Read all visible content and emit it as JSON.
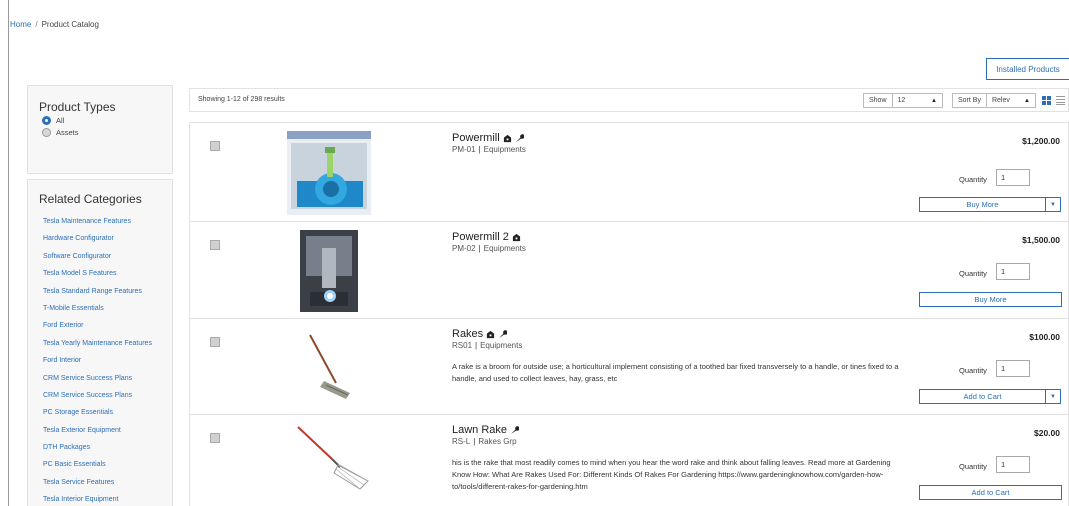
{
  "breadcrumb": {
    "home": "Home",
    "separator": "/",
    "current": "Product Catalog"
  },
  "header": {
    "installed_products": "Installed Products"
  },
  "sidebar": {
    "product_types": {
      "title": "Product Types",
      "options": [
        {
          "label": "All",
          "selected": true
        },
        {
          "label": "Assets",
          "selected": false
        }
      ]
    },
    "related_categories": {
      "title": "Related Categories",
      "items": [
        "Tesla Maintenance Features",
        "Hardware Configurator",
        "Software Configurator",
        "Tesla Model S Features",
        "Tesla Standard Range Features",
        "T-Mobile Essentials",
        "Ford Exterior",
        "Tesla Yearly Maintenance Features",
        "Ford Interior",
        "CRM Service Success Plans",
        "CRM Service Success Plans",
        "PC Storage Essentials",
        "Tesla Exterior Equipment",
        "DTH Packages",
        "PC Basic Essentials",
        "Tesla Service Features",
        "Tesla Interior Equipment"
      ]
    }
  },
  "results": {
    "summary": "Showing 1-12 of 298 results",
    "show_label": "Show",
    "show_value": "12",
    "sort_label": "Sort By",
    "sort_value": "Relev",
    "accent": "#2d6fb7"
  },
  "products": [
    {
      "title": "Powermill",
      "code": "PM-01",
      "category": "Equipments",
      "price": "$1,200.00",
      "description": "",
      "quantity_label": "Quantity",
      "quantity": "1",
      "action": "Buy More",
      "icons": [
        "asset-icon",
        "wrench-icon"
      ],
      "has_dropdown": true
    },
    {
      "title": "Powermill 2",
      "code": "PM-02",
      "category": "Equipments",
      "price": "$1,500.00",
      "description": "",
      "quantity_label": "Quantity",
      "quantity": "1",
      "action": "Buy More",
      "icons": [
        "asset-icon"
      ],
      "has_dropdown": false
    },
    {
      "title": "Rakes",
      "code": "RS01",
      "category": "Equipments",
      "price": "$100.00",
      "description": "A rake is a broom for outside use; a horticultural implement consisting of a toothed bar fixed transversely to a handle, or tines fixed to a handle, and used to collect leaves, hay, grass, etc",
      "quantity_label": "Quantity",
      "quantity": "1",
      "action": "Add to Cart",
      "icons": [
        "asset-icon",
        "wrench-icon"
      ],
      "has_dropdown": true
    },
    {
      "title": "Lawn Rake",
      "code": "RS-L",
      "category": "Rakes Grp",
      "price": "$20.00",
      "description": "his is the rake that most readily comes to mind when you hear the word rake and think about falling leaves. Read more at Gardening Know How: What Are Rakes Used For: Different Kinds Of Rakes For Gardening https://www.gardeningknowhow.com/garden-how-to/tools/different-rakes-for-gardening.htm",
      "quantity_label": "Quantity",
      "quantity": "1",
      "action": "Add to Cart",
      "icons": [
        "wrench-icon"
      ],
      "has_dropdown": false
    }
  ]
}
